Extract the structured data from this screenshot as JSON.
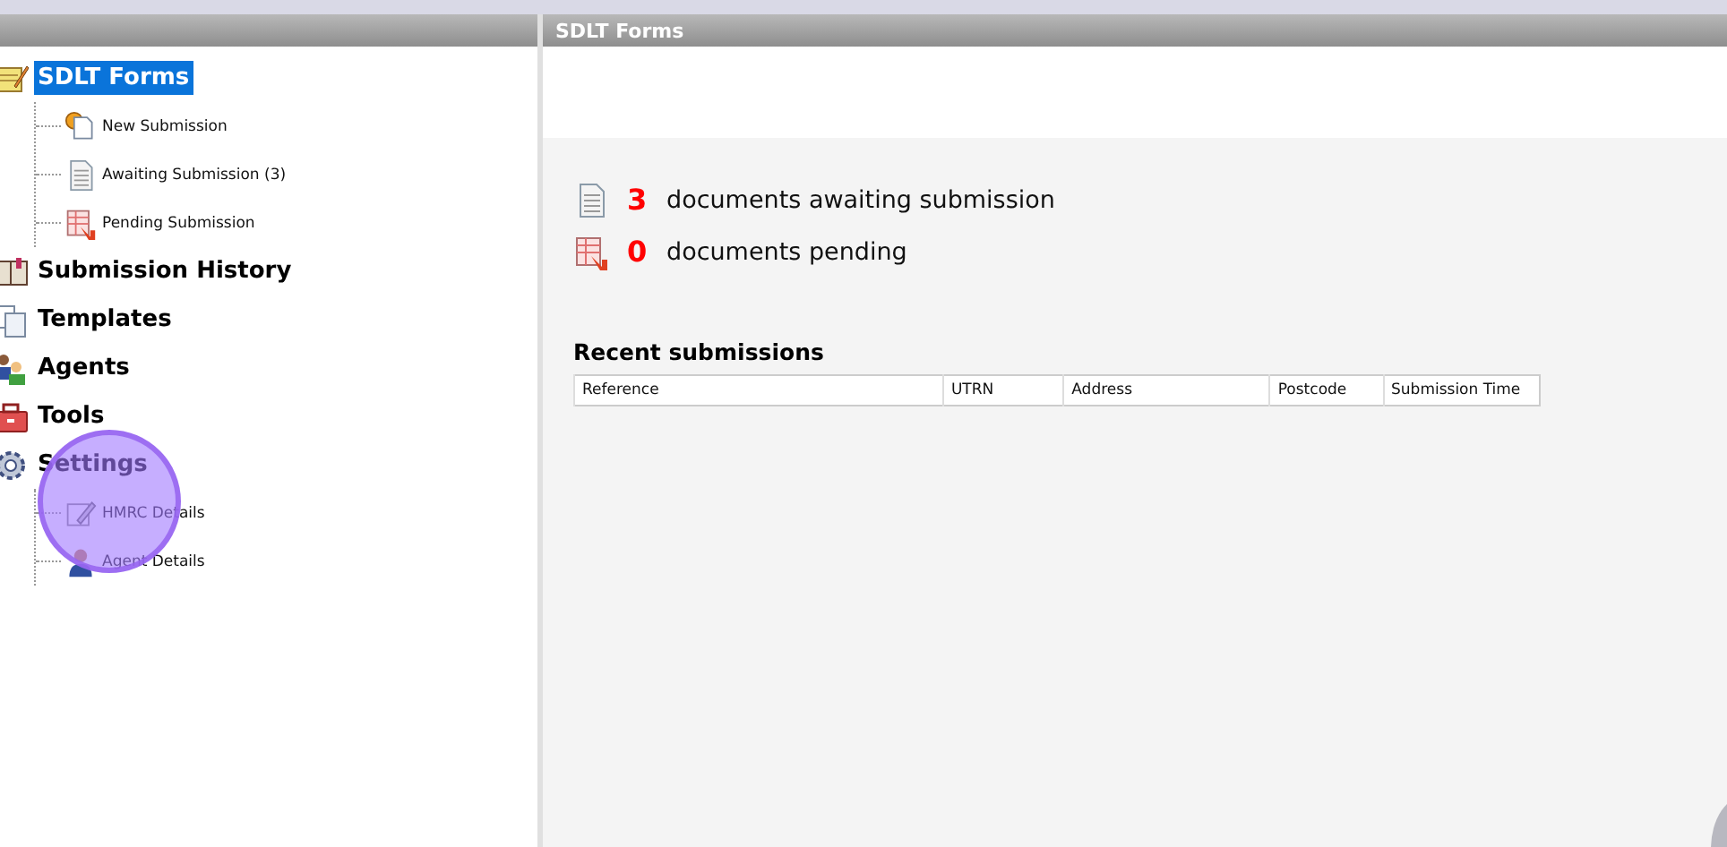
{
  "sidebar": {
    "items": [
      {
        "label": "SDLT Forms",
        "kind": "notepad",
        "selected": true,
        "children": [
          {
            "label": "New Submission",
            "kind": "new",
            "selected": false
          },
          {
            "label": "Awaiting Submission (3)",
            "kind": "awaiting",
            "selected": false
          },
          {
            "label": "Pending Submission",
            "kind": "pending",
            "selected": false
          }
        ]
      },
      {
        "label": "Submission History",
        "kind": "history",
        "selected": false
      },
      {
        "label": "Templates",
        "kind": "templates",
        "selected": false
      },
      {
        "label": "Agents",
        "kind": "agents",
        "selected": false
      },
      {
        "label": "Tools",
        "kind": "tools",
        "selected": false
      },
      {
        "label": "Settings",
        "kind": "settings",
        "selected": false,
        "children": [
          {
            "label": "HMRC Details",
            "kind": "details",
            "selected": false
          },
          {
            "label": "Agent Details",
            "kind": "agent",
            "selected": false
          }
        ]
      }
    ]
  },
  "main": {
    "title": "SDLT Forms",
    "summary": [
      {
        "kind": "awaiting",
        "count": "3",
        "text": "documents awaiting submission"
      },
      {
        "kind": "pending",
        "count": "0",
        "text": "documents pending"
      }
    ],
    "recent": {
      "title": "Recent submissions",
      "columns": [
        "Reference",
        "UTRN",
        "Address",
        "Postcode",
        "Submission Time"
      ]
    }
  }
}
